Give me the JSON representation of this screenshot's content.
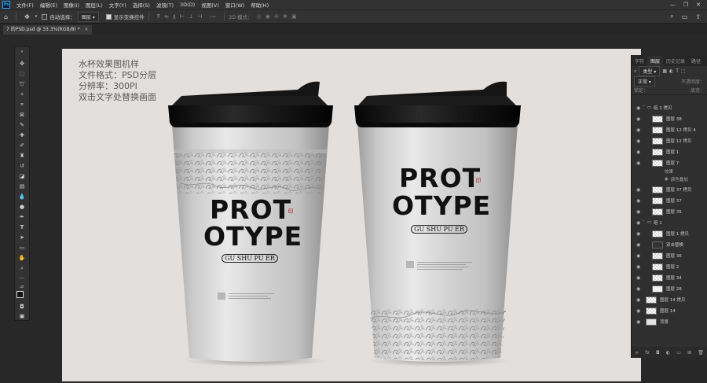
{
  "app": {
    "logo": "Ps"
  },
  "menu": [
    "文件(F)",
    "编辑(E)",
    "图像(I)",
    "图层(L)",
    "文字(Y)",
    "选择(S)",
    "滤镜(T)",
    "3D(D)",
    "视图(V)",
    "窗口(W)",
    "帮助(H)"
  ],
  "window_controls": {
    "min": "—",
    "max": "❐",
    "close": "✕"
  },
  "options": {
    "auto_select_label": "自动选择：",
    "auto_select_value": "图层",
    "show_transform_label": "显示变换控件",
    "mode_3d_label": "3D 模式："
  },
  "document": {
    "tab_title": "7 的PSD.psd @ 33.3%(RGB/8) *",
    "close": "×"
  },
  "canvas_notes": [
    "水杯效果图机样",
    "文件格式：PSD分层",
    "分辨率：300PI",
    "双击文字处替换画面"
  ],
  "cups": [
    {
      "title_line1": "PROT",
      "title_line2": "OTYPE",
      "subtitle": "GU SHU PU ER",
      "seal": "印"
    },
    {
      "title_line1": "PROT",
      "title_line2": "OTYPE",
      "subtitle": "GU SHU PU ER",
      "seal": "印"
    }
  ],
  "panel": {
    "tabs": [
      "字符",
      "图层",
      "历史记录",
      "路径"
    ],
    "active_tab": 1,
    "filter_label": "类型",
    "blend_mode": "正常",
    "opacity_label": "不透明度：",
    "lock_label": "锁定：",
    "fill_label": "填充：",
    "layers": [
      {
        "name": "组 1 拷贝",
        "type": "group",
        "indent": 0
      },
      {
        "name": "图层 38",
        "type": "layer",
        "indent": 1
      },
      {
        "name": "图层 12 拷贝 4",
        "type": "layer",
        "indent": 1
      },
      {
        "name": "图层 12 拷贝",
        "type": "layer",
        "indent": 1
      },
      {
        "name": "图层 1",
        "type": "layer",
        "indent": 1
      },
      {
        "name": "图层 7",
        "type": "layer",
        "indent": 1
      },
      {
        "name": "效果",
        "type": "effect",
        "indent": 2
      },
      {
        "name": "颜色叠加",
        "type": "effect",
        "indent": 2
      },
      {
        "name": "图层 37 拷贝",
        "type": "layer",
        "indent": 1
      },
      {
        "name": "图层 37",
        "type": "layer",
        "indent": 1
      },
      {
        "name": "图层 35",
        "type": "layer",
        "indent": 1
      },
      {
        "name": "组 1",
        "type": "group",
        "indent": 0
      },
      {
        "name": "图层 1 拷贝",
        "type": "layer",
        "indent": 1
      },
      {
        "name": "双击替换",
        "type": "smart",
        "indent": 1
      },
      {
        "name": "图层 36",
        "type": "layer",
        "indent": 1
      },
      {
        "name": "图层 2",
        "type": "layer",
        "indent": 1
      },
      {
        "name": "图层 34",
        "type": "layer",
        "indent": 1
      },
      {
        "name": "图层 28",
        "type": "layer",
        "indent": 1
      },
      {
        "name": "图层 14 拷贝",
        "type": "layer",
        "indent": 0
      },
      {
        "name": "图层 14",
        "type": "layer",
        "indent": 0
      },
      {
        "name": "背景",
        "type": "background",
        "indent": 0
      }
    ],
    "footer_icons": [
      "link-icon",
      "fx-icon",
      "mask-icon",
      "adjustment-icon",
      "folder-icon",
      "new-layer-icon",
      "trash-icon"
    ]
  },
  "colors": {
    "accent": "#31a8ff",
    "lid": "#121212",
    "seal": "#b3262a"
  }
}
